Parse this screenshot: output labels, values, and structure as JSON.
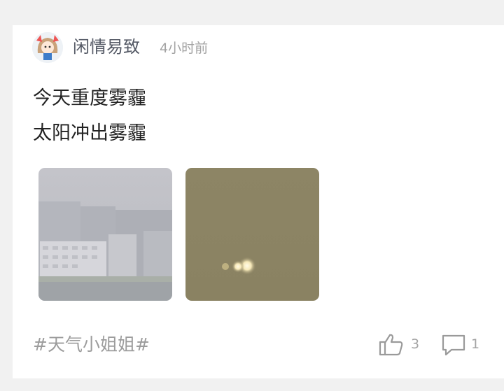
{
  "post": {
    "author": {
      "name": "闲情易致",
      "avatar_icon": "anime-girl-avatar"
    },
    "time": "4小时前",
    "content_lines": [
      "今天重度雾霾",
      "太阳冲出雾霾"
    ],
    "images": [
      {
        "name": "smog-buildings-photo"
      },
      {
        "name": "hazy-sun-photo"
      }
    ],
    "hashtag": "#天气小姐姐#",
    "actions": {
      "likes": "3",
      "comments": "1"
    }
  },
  "colors": {
    "background": "#f1f1f1",
    "card": "#ffffff",
    "muted_text": "#a3a3a3",
    "body_text": "#222222"
  }
}
